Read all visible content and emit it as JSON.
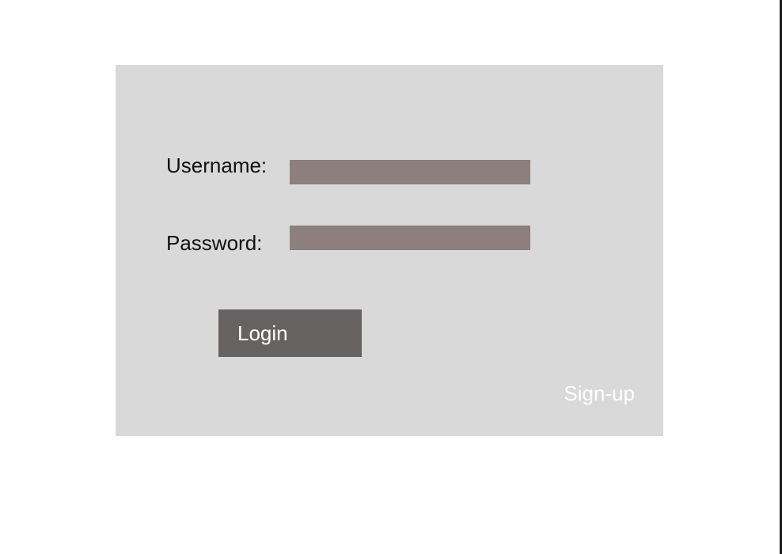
{
  "login_form": {
    "username_label": "Username:",
    "username_value": "",
    "password_label": "Password:",
    "password_value": "",
    "login_button_label": "Login",
    "signup_link_label": "Sign-up"
  },
  "colors": {
    "page_background": "#ffffff",
    "panel_background": "#d9d9d9",
    "input_fill": "#8c7f7e",
    "button_fill": "#676262",
    "label_text": "#111111",
    "button_text": "#ffffff",
    "link_text": "#ffffff",
    "right_edge_border": "#1b1b1b"
  }
}
